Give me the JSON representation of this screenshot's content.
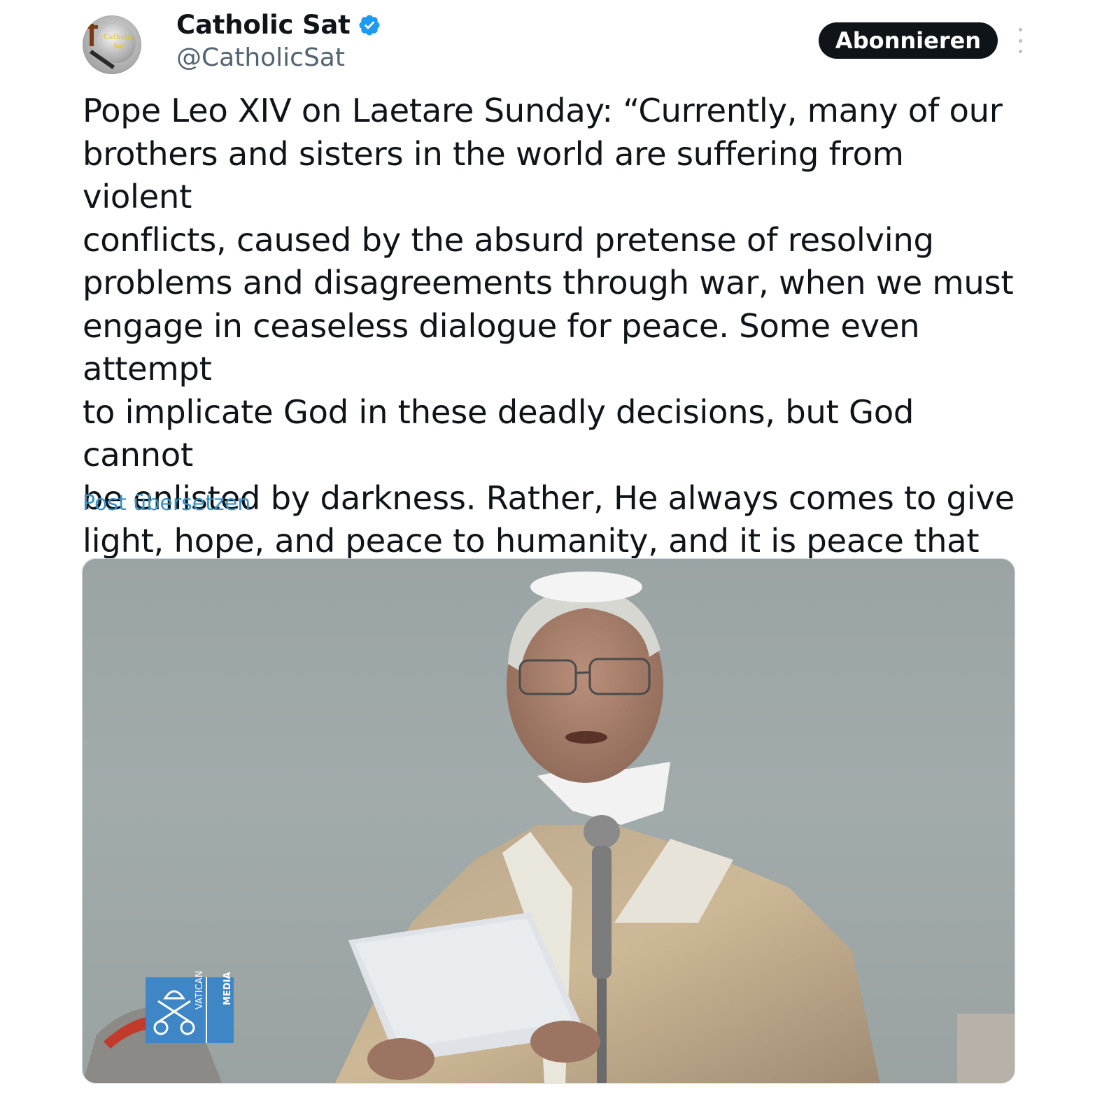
{
  "author": {
    "name": "Catholic Sat",
    "handle": "@CatholicSat",
    "verified": true,
    "avatar_text_line1": "Catholic",
    "avatar_text_line2": "Sat"
  },
  "actions": {
    "follow_label": "Abonnieren",
    "more_icon": "more-vertical-icon"
  },
  "post": {
    "text": "Pope Leo XIV on Laetare Sunday: “Currently, many of our\nbrothers and sisters in the world are suffering from violent\nconflicts, caused by the absurd pretense of resolving\nproblems and disagreements through war, when we must\nengage in ceaseless dialogue for peace. Some even attempt\nto implicate God in these deadly decisions, but God cannot\nbe enlisted by darkness. Rather, He always comes to give\nlight, hope, and peace to humanity, and it is peace that\nthose who invoke him must seek.”",
    "translate_label": "Post übersetzen"
  },
  "media": {
    "watermark_line1": "VATICAN",
    "watermark_line2": "MEDIA"
  },
  "colors": {
    "follow_bg": "#0f1419",
    "verified": "#1d9bf0",
    "link": "#3b93c7",
    "handle": "#536471"
  }
}
